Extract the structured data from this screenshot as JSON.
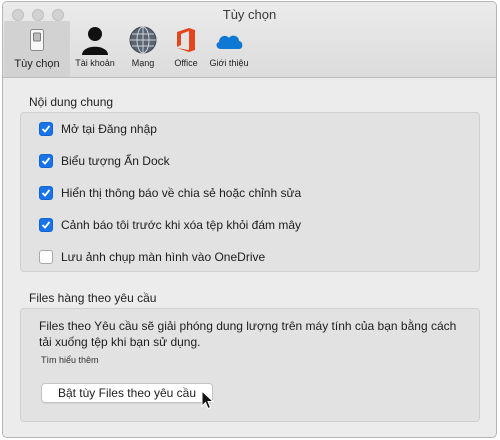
{
  "window": {
    "title": "Tùy chọn"
  },
  "toolbar": {
    "items": [
      {
        "label": "Tùy chọn",
        "icon": "switch-icon",
        "active": true
      },
      {
        "label": "Tài khoản",
        "icon": "person-icon",
        "active": false
      },
      {
        "label": "Mạng",
        "icon": "globe-icon",
        "active": false
      },
      {
        "label": "Office",
        "icon": "office-icon",
        "active": false
      },
      {
        "label": "Giới thiệu",
        "icon": "onedrive-cloud-icon",
        "active": false
      }
    ]
  },
  "general": {
    "heading": "Nội dung chung",
    "options": [
      {
        "label": "Mở tại Đăng nhập",
        "checked": true
      },
      {
        "label": "Biểu tượng Ẩn Dock",
        "checked": true
      },
      {
        "label": "Hiển thị thông báo về chia sẻ hoặc chỉnh sửa",
        "checked": true
      },
      {
        "label": "Cảnh báo tôi trước khi xóa tệp khỏi đám mây",
        "checked": true
      },
      {
        "label": "Lưu ảnh chụp màn hình vào OneDrive",
        "checked": false
      }
    ]
  },
  "files_on_demand": {
    "heading": "Files hàng theo yêu cầu",
    "description": "Files theo Yêu cầu sẽ giải phóng dung lượng trên máy tính của bạn bằng cách tải xuống tệp khi bạn sử dụng.",
    "learn_more": "Tìm hiểu thêm",
    "button_label": "Bật tùy Files theo yêu cầu"
  },
  "colors": {
    "accent": "#1a73e8",
    "office": "#e3461b",
    "onedrive": "#0f78d4"
  }
}
